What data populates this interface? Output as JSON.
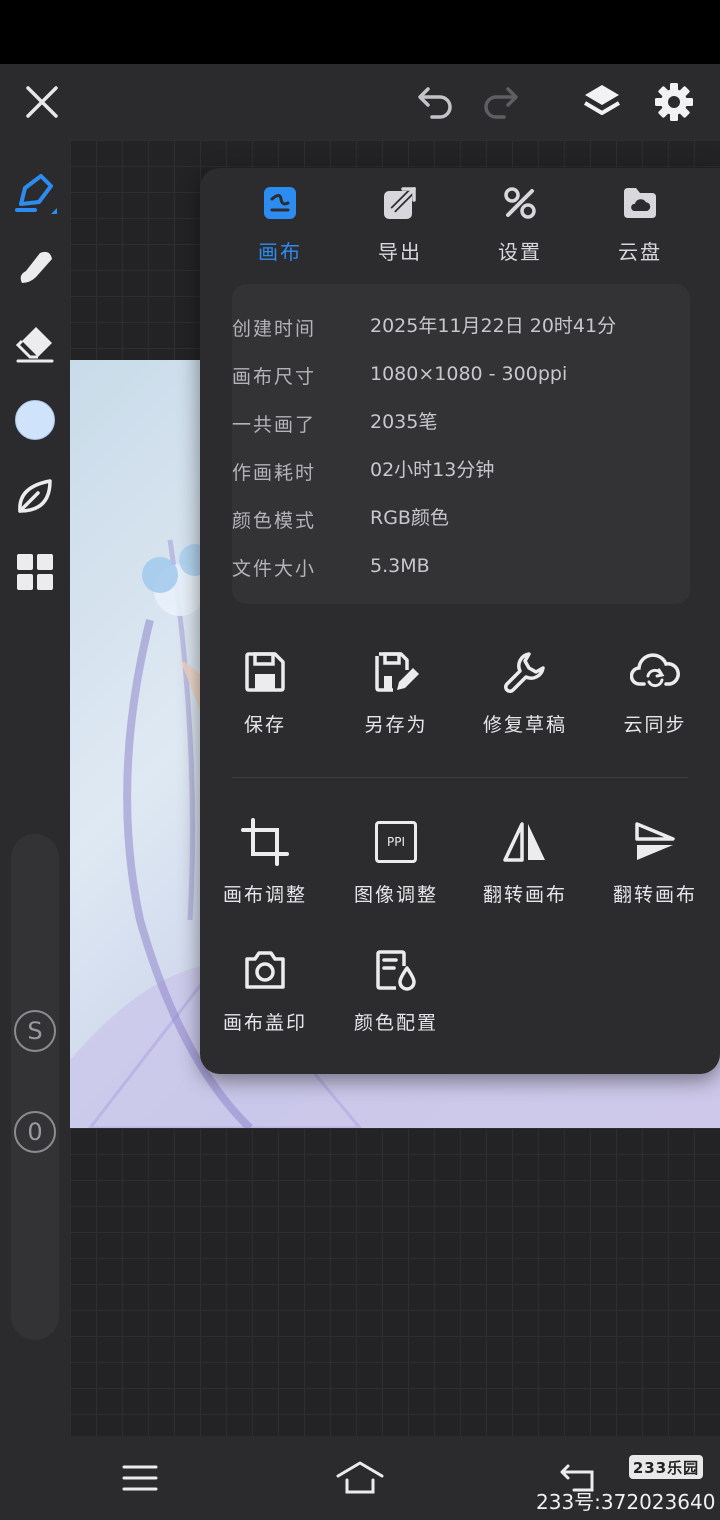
{
  "top_bar": {
    "icons": [
      "close-icon",
      "undo-icon",
      "redo-icon",
      "layers-icon",
      "settings-gear-icon"
    ]
  },
  "left_toolbar": {
    "tools": [
      "pen-tool-icon",
      "smudge-brush-icon",
      "eraser-icon",
      "color-swatch",
      "leaf-brush-icon",
      "grid-menu-icon"
    ],
    "color_swatch": "#cfe3fb",
    "accent": "#2d8cf0",
    "size_slider_label": "S",
    "opacity_slider_label": "0"
  },
  "panel": {
    "tabs": [
      {
        "label": "画布",
        "icon": "canvas-icon",
        "active": true
      },
      {
        "label": "导出",
        "icon": "export-icon",
        "active": false
      },
      {
        "label": "设置",
        "icon": "tools-icon",
        "active": false
      },
      {
        "label": "云盘",
        "icon": "cloud-folder-icon",
        "active": false
      }
    ],
    "info": [
      {
        "key": "创建时间",
        "value": "2025年11月22日 20时41分"
      },
      {
        "key": "画布尺寸",
        "value": "1080×1080 - 300ppi"
      },
      {
        "key": "一共画了",
        "value": "2035笔"
      },
      {
        "key": "作画耗时",
        "value": "02小时13分钟"
      },
      {
        "key": "颜色模式",
        "value": "RGB颜色"
      },
      {
        "key": "文件大小",
        "value": "5.3MB"
      }
    ],
    "actions_row1": [
      {
        "label": "保存",
        "icon": "save-icon"
      },
      {
        "label": "另存为",
        "icon": "save-as-icon"
      },
      {
        "label": "修复草稿",
        "icon": "wrench-icon"
      },
      {
        "label": "云同步",
        "icon": "cloud-sync-icon"
      }
    ],
    "actions_row2": [
      {
        "label": "画布调整",
        "icon": "crop-icon"
      },
      {
        "label": "图像调整",
        "icon": "ppi-icon",
        "badge": "PPI"
      },
      {
        "label": "翻转画布",
        "icon": "flip-horizontal-icon"
      },
      {
        "label": "翻转画布",
        "icon": "flip-vertical-icon"
      }
    ],
    "actions_row3": [
      {
        "label": "画布盖印",
        "icon": "camera-stamp-icon"
      },
      {
        "label": "颜色配置",
        "icon": "color-profile-icon"
      }
    ]
  },
  "bottom_nav": {
    "icons": [
      "menu-icon",
      "home-icon",
      "back-icon"
    ]
  },
  "watermark": {
    "badge": "233乐园",
    "text": "233号:372023640"
  }
}
